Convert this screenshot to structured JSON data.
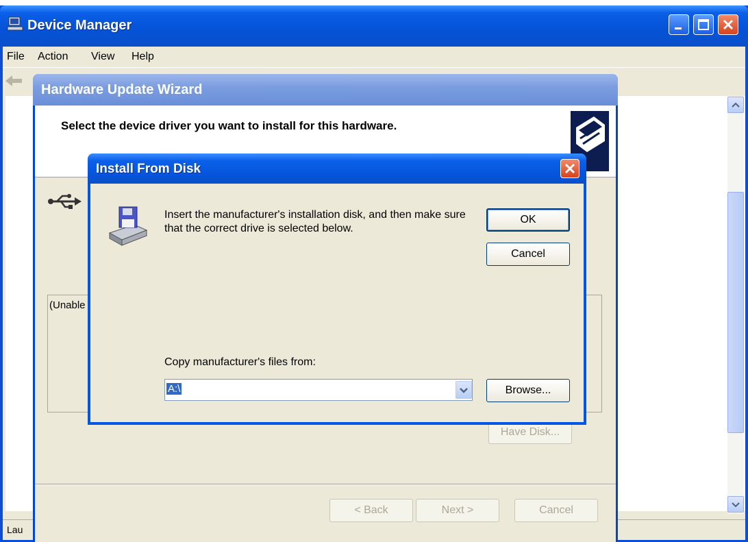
{
  "device_manager": {
    "title": "Device Manager",
    "menu": [
      "File",
      "Action",
      "View",
      "Help"
    ],
    "status_text": "Lau",
    "icons": {
      "app": "computer-icon",
      "back": "back-arrow-icon"
    }
  },
  "wizard": {
    "title": "Hardware Update Wizard",
    "header_text": "Select the device driver you want to install for this hardware.",
    "list_text": "(Unable",
    "have_disk_label": "Have Disk...",
    "back_label": "< Back",
    "next_label": "Next >",
    "cancel_label": "Cancel",
    "icons": {
      "header": "hardware-icon",
      "device": "usb-icon"
    }
  },
  "install_from_disk": {
    "title": "Install From Disk",
    "message": "Insert the manufacturer's installation disk, and then make sure that the correct drive is selected below.",
    "ok_label": "OK",
    "cancel_label": "Cancel",
    "copy_label": "Copy manufacturer's files from:",
    "path_value": "A:\\",
    "browse_label": "Browse...",
    "icons": {
      "disk": "floppy-drive-icon",
      "close": "close-icon"
    }
  },
  "colors": {
    "titlebar_blue": "#0a5fe8",
    "inactive_titlebar": "#7c9ee0",
    "dialog_face": "#ece9d8",
    "close_red": "#d8421d",
    "selection": "#316ac5"
  }
}
